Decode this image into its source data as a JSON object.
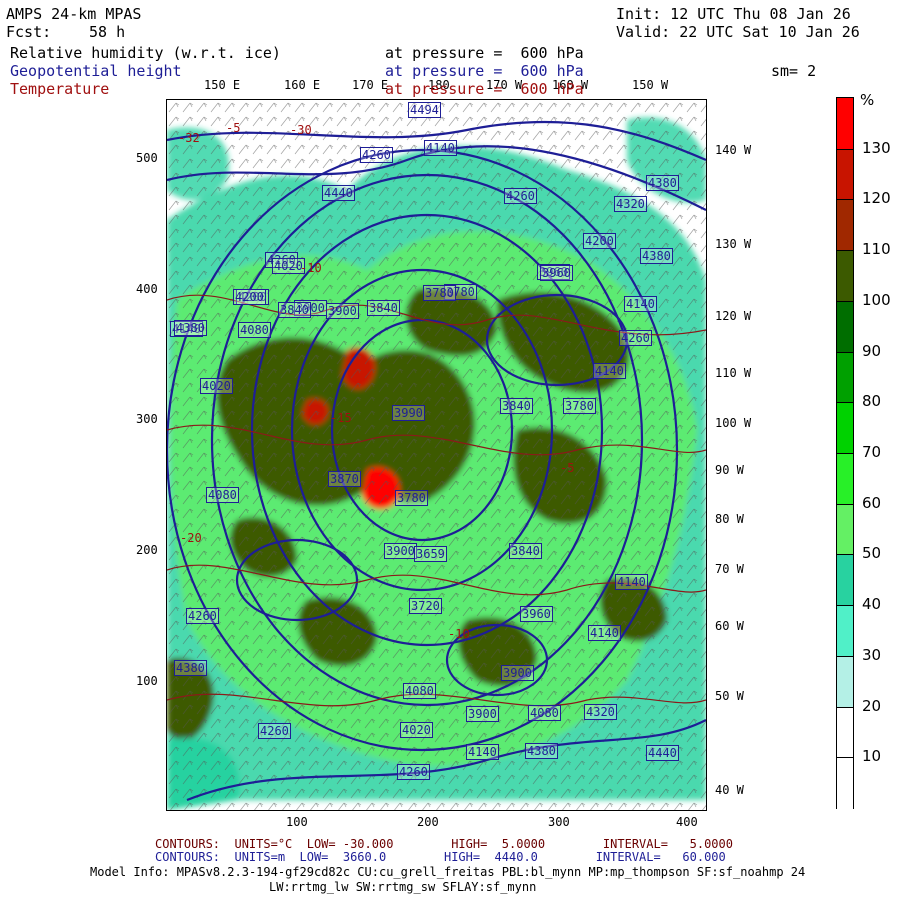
{
  "header": {
    "title": "AMPS 24-km MPAS",
    "init": "Init: 12 UTC Thu 08 Jan 26",
    "fcst_label": "Fcst:",
    "fcst_value": "58 h",
    "valid": "Valid: 22 UTC Sat 10 Jan 26",
    "smoothing": "sm= 2",
    "fields": [
      {
        "name": "Relative humidity (w.r.t. ice)",
        "level": "at pressure =  600 hPa",
        "color": "#000000"
      },
      {
        "name": "Geopotential height",
        "level": "at pressure =  600 hPa",
        "color": "#1e1e96"
      },
      {
        "name": "Temperature",
        "level": "at pressure =  600 hPa",
        "color": "#a01010"
      }
    ]
  },
  "axes": {
    "x_ticks": [
      "100",
      "200",
      "300",
      "400"
    ],
    "y_ticks": [
      "500",
      "400",
      "300",
      "200",
      "100"
    ]
  },
  "longitudes_top": [
    "150 E",
    "160 E",
    "170 E",
    "180",
    "170 W",
    "160 W",
    "150 W"
  ],
  "longitudes_right": [
    "140 W",
    "130 W",
    "120 W",
    "110 W",
    "100 W",
    "90 W",
    "80 W",
    "70 W",
    "60 W",
    "50 W",
    "40 W"
  ],
  "colorbar": {
    "unit": "%",
    "labels": [
      "130",
      "120",
      "110",
      "100",
      "90",
      "80",
      "70",
      "60",
      "50",
      "40",
      "30",
      "20",
      "10"
    ],
    "colors": [
      "#ff0000",
      "#c81400",
      "#a02800",
      "#3c5a00",
      "#006e00",
      "#00a000",
      "#00d200",
      "#28f028",
      "#64f064",
      "#28d2a0",
      "#50f0c8",
      "#b4f0e6",
      "#ffffff",
      "#ffffff"
    ]
  },
  "height_labels": [
    "4494",
    "4260",
    "4140",
    "4260",
    "4380",
    "4320",
    "4200",
    "4380",
    "4440",
    "4140",
    "4260",
    "4200",
    "4140",
    "3900",
    "3780",
    "3840",
    "4080",
    "4140",
    "4260",
    "4020",
    "3960",
    "3840",
    "3780",
    "3900",
    "4080",
    "4320",
    "4380",
    "4200",
    "3990",
    "3840",
    "3900",
    "4020",
    "3960",
    "3780",
    "3870",
    "3780",
    "3659",
    "3840",
    "3720",
    "3900",
    "3960",
    "4140",
    "3900",
    "4260",
    "4080",
    "4020",
    "4140",
    "4260",
    "4080",
    "4320",
    "4380",
    "4260",
    "4080",
    "4020",
    "3960",
    "3900",
    "4140",
    "4320",
    "4440",
    "4380"
  ],
  "temperature_labels": [
    "-32",
    "-5",
    "-30",
    "-10",
    "-20",
    "-15",
    "-10",
    "-5"
  ],
  "footer": {
    "temp_contours": "CONTOURS:  UNITS=°C  LOW= -30.000        HIGH=  5.0000        INTERVAL=   5.0000",
    "height_contours": "CONTOURS:  UNITS=m  LOW=  3660.0        HIGH=  4440.0        INTERVAL=   60.000",
    "model_info_1": "Model Info: MPASv8.2.3-194-gf29cd82c CU:cu_grell_freitas PBL:bl_mynn MP:mp_thompson SF:sf_noahmp 24",
    "model_info_2": "LW:rrtmg_lw SW:rrtmg_sw SFLAY:sf_mynn"
  }
}
